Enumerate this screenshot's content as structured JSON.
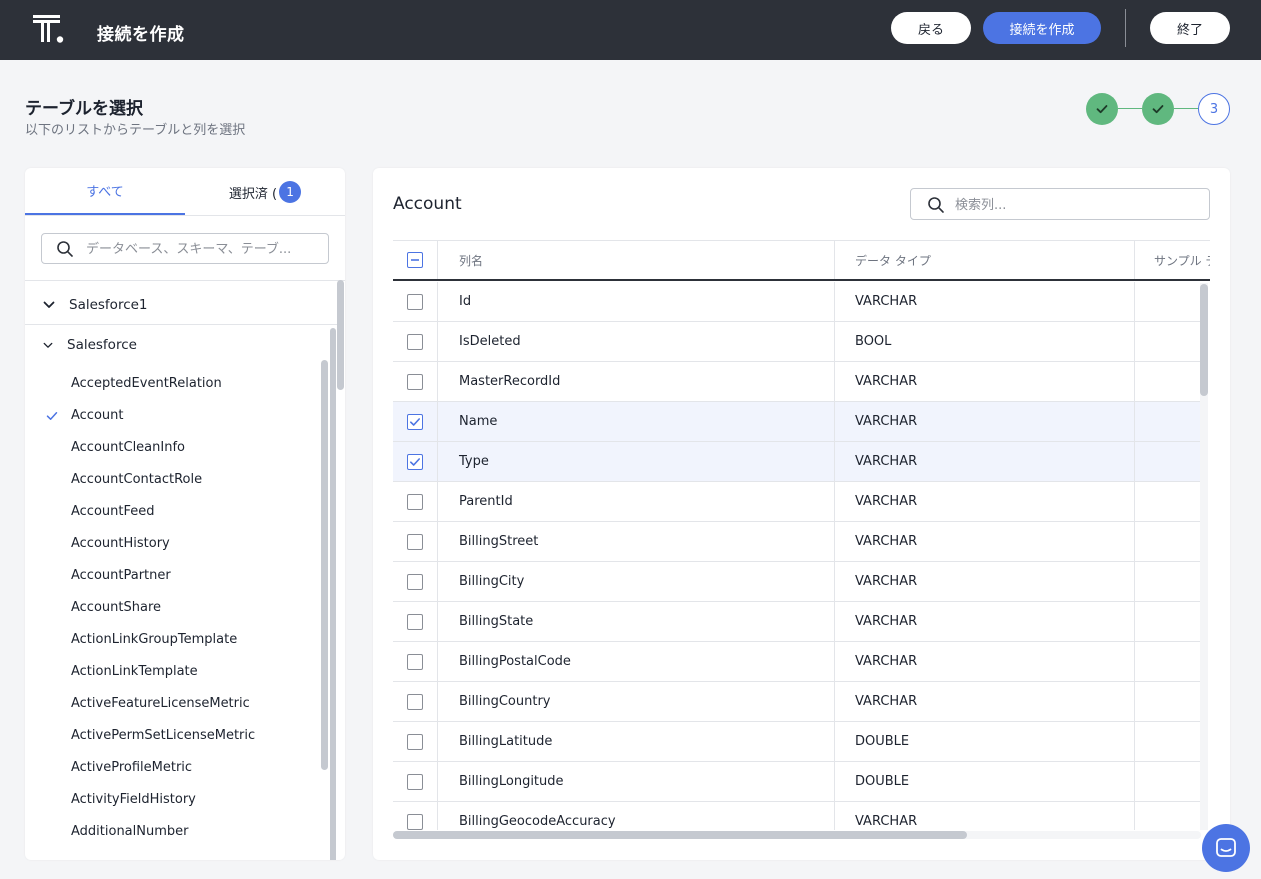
{
  "header": {
    "title": "接続を作成",
    "back_label": "戻る",
    "create_label": "接続を作成",
    "exit_label": "終了"
  },
  "page": {
    "title": "テーブルを選択",
    "subtitle": "以下のリストからテーブルと列を選択"
  },
  "stepper": {
    "steps": [
      {
        "state": "done"
      },
      {
        "state": "done"
      },
      {
        "state": "current",
        "label": "3"
      }
    ]
  },
  "left": {
    "tab_all": "すべて",
    "tab_selected": "選択済 (",
    "selected_count": "1",
    "search_placeholder": "データベース、スキーマ、テーブ...",
    "databases": [
      {
        "name": "Salesforce1",
        "expanded": false
      },
      {
        "name": "Salesforce",
        "expanded": true
      }
    ],
    "tables": [
      {
        "name": "AcceptedEventRelation",
        "selected": false
      },
      {
        "name": "Account",
        "selected": true
      },
      {
        "name": "AccountCleanInfo",
        "selected": false
      },
      {
        "name": "AccountContactRole",
        "selected": false
      },
      {
        "name": "AccountFeed",
        "selected": false
      },
      {
        "name": "AccountHistory",
        "selected": false
      },
      {
        "name": "AccountPartner",
        "selected": false
      },
      {
        "name": "AccountShare",
        "selected": false
      },
      {
        "name": "ActionLinkGroupTemplate",
        "selected": false
      },
      {
        "name": "ActionLinkTemplate",
        "selected": false
      },
      {
        "name": "ActiveFeatureLicenseMetric",
        "selected": false
      },
      {
        "name": "ActivePermSetLicenseMetric",
        "selected": false
      },
      {
        "name": "ActiveProfileMetric",
        "selected": false
      },
      {
        "name": "ActivityFieldHistory",
        "selected": false
      },
      {
        "name": "AdditionalNumber",
        "selected": false
      }
    ]
  },
  "right": {
    "table_name": "Account",
    "search_placeholder": "検索列...",
    "columns": {
      "name": "列名",
      "type": "データ タイプ",
      "sample": "サンプル デ"
    },
    "rows": [
      {
        "name": "Id",
        "type": "VARCHAR",
        "checked": false
      },
      {
        "name": "IsDeleted",
        "type": "BOOL",
        "checked": false
      },
      {
        "name": "MasterRecordId",
        "type": "VARCHAR",
        "checked": false
      },
      {
        "name": "Name",
        "type": "VARCHAR",
        "checked": true
      },
      {
        "name": "Type",
        "type": "VARCHAR",
        "checked": true
      },
      {
        "name": "ParentId",
        "type": "VARCHAR",
        "checked": false
      },
      {
        "name": "BillingStreet",
        "type": "VARCHAR",
        "checked": false
      },
      {
        "name": "BillingCity",
        "type": "VARCHAR",
        "checked": false
      },
      {
        "name": "BillingState",
        "type": "VARCHAR",
        "checked": false
      },
      {
        "name": "BillingPostalCode",
        "type": "VARCHAR",
        "checked": false
      },
      {
        "name": "BillingCountry",
        "type": "VARCHAR",
        "checked": false
      },
      {
        "name": "BillingLatitude",
        "type": "DOUBLE",
        "checked": false
      },
      {
        "name": "BillingLongitude",
        "type": "DOUBLE",
        "checked": false
      },
      {
        "name": "BillingGeocodeAccuracy",
        "type": "VARCHAR",
        "checked": false
      }
    ]
  },
  "colors": {
    "accent": "#4c74e3",
    "success": "#60b87f",
    "topbar": "#2d3139"
  },
  "icons": {
    "logo": "thoughtspot-logo",
    "search": "search-icon",
    "chevron": "chevron-down-icon",
    "check": "check-icon",
    "chat": "chat-icon"
  }
}
